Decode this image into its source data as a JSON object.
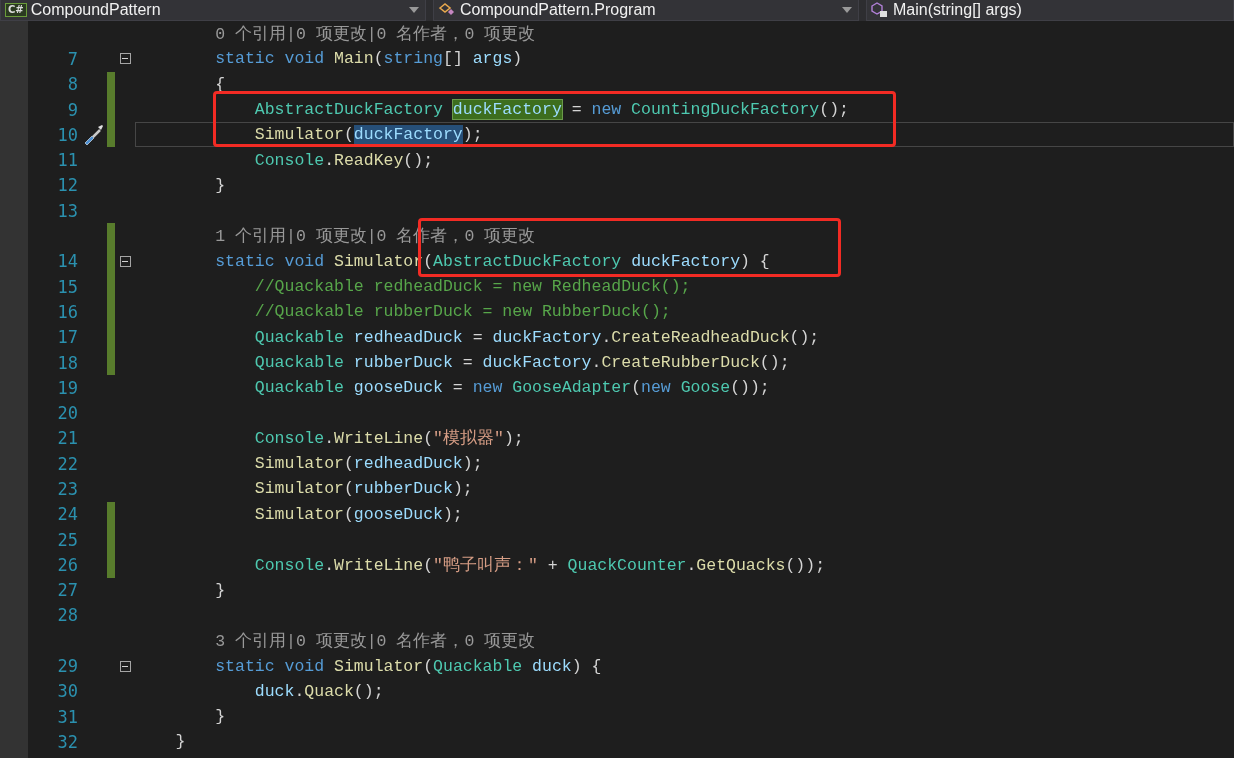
{
  "navigation_bar": [
    {
      "kind": "project",
      "badge": "C#",
      "label": "CompoundPattern",
      "caret": true
    },
    {
      "kind": "class",
      "label": "CompoundPattern.Program",
      "caret": true
    },
    {
      "kind": "member",
      "label": "Main(string[] args)",
      "caret": false
    }
  ],
  "lines": [
    {
      "kind": "codelens",
      "text": "        0 个引用|0 项更改|0 名作者，0 项更改",
      "changed": false
    },
    {
      "kind": "code",
      "number": "7",
      "changed": false,
      "fold_toggle": true,
      "current": false,
      "action_hint": false,
      "code": [
        {
          "text": "        static void ",
          "kind": "keyword"
        },
        {
          "text": "Main",
          "kind": "method"
        },
        {
          "text": "(",
          "kind": "plain"
        },
        {
          "text": "string",
          "kind": "keyword"
        },
        {
          "text": "[] ",
          "kind": "plain"
        },
        {
          "text": "args",
          "kind": "ident"
        },
        {
          "text": ")",
          "kind": "plain"
        }
      ]
    },
    {
      "kind": "code",
      "number": "8",
      "changed": true,
      "fold_toggle": false,
      "current": false,
      "action_hint": false,
      "code": [
        {
          "text": "        {",
          "kind": "plain"
        }
      ]
    },
    {
      "kind": "code",
      "number": "9",
      "changed": true,
      "fold_toggle": false,
      "current": false,
      "action_hint": false,
      "code": [
        {
          "text": "            AbstractDuckFactory ",
          "kind": "type"
        },
        {
          "text": "duckFactory",
          "kind": "ident",
          "reference_highlight": true
        },
        {
          "text": " = ",
          "kind": "plain"
        },
        {
          "text": "new ",
          "kind": "keyword"
        },
        {
          "text": "CountingDuckFactory",
          "kind": "type"
        },
        {
          "text": "();",
          "kind": "plain"
        }
      ]
    },
    {
      "kind": "code",
      "number": "10",
      "changed": true,
      "fold_toggle": false,
      "current": true,
      "action_hint": true,
      "code": [
        {
          "text": "            Simulator",
          "kind": "method"
        },
        {
          "text": "(",
          "kind": "plain"
        },
        {
          "text": "duckFactory",
          "kind": "ident",
          "text_selected": true
        },
        {
          "text": ");",
          "kind": "plain"
        }
      ]
    },
    {
      "kind": "code",
      "number": "11",
      "changed": false,
      "fold_toggle": false,
      "current": false,
      "action_hint": false,
      "code": [
        {
          "text": "            Console",
          "kind": "type"
        },
        {
          "text": ".",
          "kind": "plain"
        },
        {
          "text": "ReadKey",
          "kind": "method"
        },
        {
          "text": "();",
          "kind": "plain"
        }
      ]
    },
    {
      "kind": "code",
      "number": "12",
      "changed": false,
      "fold_toggle": false,
      "current": false,
      "action_hint": false,
      "code": [
        {
          "text": "        }",
          "kind": "plain"
        }
      ]
    },
    {
      "kind": "code",
      "number": "13",
      "changed": false,
      "fold_toggle": false,
      "current": false,
      "action_hint": false
    },
    {
      "kind": "codelens",
      "text": "        1 个引用|0 项更改|0 名作者，0 项更改",
      "changed": true
    },
    {
      "kind": "code",
      "number": "14",
      "changed": true,
      "fold_toggle": true,
      "current": false,
      "action_hint": false,
      "code": [
        {
          "text": "        static void ",
          "kind": "keyword"
        },
        {
          "text": "Simulator",
          "kind": "method"
        },
        {
          "text": "(",
          "kind": "plain"
        },
        {
          "text": "AbstractDuckFactory ",
          "kind": "type"
        },
        {
          "text": "duckFactory",
          "kind": "ident"
        },
        {
          "text": ") {",
          "kind": "plain"
        }
      ]
    },
    {
      "kind": "code",
      "number": "15",
      "changed": true,
      "fold_toggle": false,
      "current": false,
      "action_hint": false,
      "code": [
        {
          "text": "            //Quackable redheadDuck = new RedheadDuck();",
          "kind": "comment"
        }
      ]
    },
    {
      "kind": "code",
      "number": "16",
      "changed": true,
      "fold_toggle": false,
      "current": false,
      "action_hint": false,
      "code": [
        {
          "text": "            //Quackable rubberDuck = new RubberDuck();",
          "kind": "comment"
        }
      ]
    },
    {
      "kind": "code",
      "number": "17",
      "changed": true,
      "fold_toggle": false,
      "current": false,
      "action_hint": false,
      "code": [
        {
          "text": "            Quackable ",
          "kind": "type"
        },
        {
          "text": "redheadDuck",
          "kind": "ident"
        },
        {
          "text": " = ",
          "kind": "plain"
        },
        {
          "text": "duckFactory",
          "kind": "ident"
        },
        {
          "text": ".",
          "kind": "plain"
        },
        {
          "text": "CreateReadheadDuck",
          "kind": "method"
        },
        {
          "text": "();",
          "kind": "plain"
        }
      ]
    },
    {
      "kind": "code",
      "number": "18",
      "changed": true,
      "fold_toggle": false,
      "current": false,
      "action_hint": false,
      "code": [
        {
          "text": "            Quackable ",
          "kind": "type"
        },
        {
          "text": "rubberDuck",
          "kind": "ident"
        },
        {
          "text": " = ",
          "kind": "plain"
        },
        {
          "text": "duckFactory",
          "kind": "ident"
        },
        {
          "text": ".",
          "kind": "plain"
        },
        {
          "text": "CreateRubberDuck",
          "kind": "method"
        },
        {
          "text": "();",
          "kind": "plain"
        }
      ]
    },
    {
      "kind": "code",
      "number": "19",
      "changed": false,
      "fold_toggle": false,
      "current": false,
      "action_hint": false,
      "code": [
        {
          "text": "            Quackable ",
          "kind": "type"
        },
        {
          "text": "gooseDuck",
          "kind": "ident"
        },
        {
          "text": " = ",
          "kind": "plain"
        },
        {
          "text": "new ",
          "kind": "keyword"
        },
        {
          "text": "GooseAdapter",
          "kind": "type"
        },
        {
          "text": "(",
          "kind": "plain"
        },
        {
          "text": "new ",
          "kind": "keyword"
        },
        {
          "text": "Goose",
          "kind": "type"
        },
        {
          "text": "());",
          "kind": "plain"
        }
      ]
    },
    {
      "kind": "code",
      "number": "20",
      "changed": false,
      "fold_toggle": false,
      "current": false,
      "action_hint": false
    },
    {
      "kind": "code",
      "number": "21",
      "changed": false,
      "fold_toggle": false,
      "current": false,
      "action_hint": false,
      "code": [
        {
          "text": "            Console",
          "kind": "type"
        },
        {
          "text": ".",
          "kind": "plain"
        },
        {
          "text": "WriteLine",
          "kind": "method"
        },
        {
          "text": "(",
          "kind": "plain"
        },
        {
          "text": "\"模拟器\"",
          "kind": "string"
        },
        {
          "text": ");",
          "kind": "plain"
        }
      ]
    },
    {
      "kind": "code",
      "number": "22",
      "changed": false,
      "fold_toggle": false,
      "current": false,
      "action_hint": false,
      "code": [
        {
          "text": "            Simulator",
          "kind": "method"
        },
        {
          "text": "(",
          "kind": "plain"
        },
        {
          "text": "redheadDuck",
          "kind": "ident"
        },
        {
          "text": ");",
          "kind": "plain"
        }
      ]
    },
    {
      "kind": "code",
      "number": "23",
      "changed": false,
      "fold_toggle": false,
      "current": false,
      "action_hint": false,
      "code": [
        {
          "text": "            Simulator",
          "kind": "method"
        },
        {
          "text": "(",
          "kind": "plain"
        },
        {
          "text": "rubberDuck",
          "kind": "ident"
        },
        {
          "text": ");",
          "kind": "plain"
        }
      ]
    },
    {
      "kind": "code",
      "number": "24",
      "changed": true,
      "fold_toggle": false,
      "current": false,
      "action_hint": false,
      "code": [
        {
          "text": "            Simulator",
          "kind": "method"
        },
        {
          "text": "(",
          "kind": "plain"
        },
        {
          "text": "gooseDuck",
          "kind": "ident"
        },
        {
          "text": ");",
          "kind": "plain"
        }
      ]
    },
    {
      "kind": "code",
      "number": "25",
      "changed": true,
      "fold_toggle": false,
      "current": false,
      "action_hint": false
    },
    {
      "kind": "code",
      "number": "26",
      "changed": true,
      "fold_toggle": false,
      "current": false,
      "action_hint": false,
      "code": [
        {
          "text": "            Console",
          "kind": "type"
        },
        {
          "text": ".",
          "kind": "plain"
        },
        {
          "text": "WriteLine",
          "kind": "method"
        },
        {
          "text": "(",
          "kind": "plain"
        },
        {
          "text": "\"鸭子叫声：\"",
          "kind": "string"
        },
        {
          "text": " + ",
          "kind": "plain"
        },
        {
          "text": "QuackCounter",
          "kind": "type"
        },
        {
          "text": ".",
          "kind": "plain"
        },
        {
          "text": "GetQuacks",
          "kind": "method"
        },
        {
          "text": "());",
          "kind": "plain"
        }
      ]
    },
    {
      "kind": "code",
      "number": "27",
      "changed": false,
      "fold_toggle": false,
      "current": false,
      "action_hint": false,
      "code": [
        {
          "text": "        }",
          "kind": "plain"
        }
      ]
    },
    {
      "kind": "code",
      "number": "28",
      "changed": false,
      "fold_toggle": false,
      "current": false,
      "action_hint": false
    },
    {
      "kind": "codelens",
      "text": "        3 个引用|0 项更改|0 名作者，0 项更改",
      "changed": false
    },
    {
      "kind": "code",
      "number": "29",
      "changed": false,
      "fold_toggle": true,
      "current": false,
      "action_hint": false,
      "code": [
        {
          "text": "        static void ",
          "kind": "keyword"
        },
        {
          "text": "Simulator",
          "kind": "method"
        },
        {
          "text": "(",
          "kind": "plain"
        },
        {
          "text": "Quackable ",
          "kind": "type"
        },
        {
          "text": "duck",
          "kind": "ident"
        },
        {
          "text": ") {",
          "kind": "plain"
        }
      ]
    },
    {
      "kind": "code",
      "number": "30",
      "changed": false,
      "fold_toggle": false,
      "current": false,
      "action_hint": false,
      "code": [
        {
          "text": "            duck",
          "kind": "ident"
        },
        {
          "text": ".",
          "kind": "plain"
        },
        {
          "text": "Quack",
          "kind": "method"
        },
        {
          "text": "();",
          "kind": "plain"
        }
      ]
    },
    {
      "kind": "code",
      "number": "31",
      "changed": false,
      "fold_toggle": false,
      "current": false,
      "action_hint": false,
      "code": [
        {
          "text": "        }",
          "kind": "plain"
        }
      ]
    },
    {
      "kind": "code",
      "number": "32",
      "changed": false,
      "fold_toggle": false,
      "current": false,
      "action_hint": false,
      "code": [
        {
          "text": "    }",
          "kind": "plain"
        }
      ]
    }
  ]
}
